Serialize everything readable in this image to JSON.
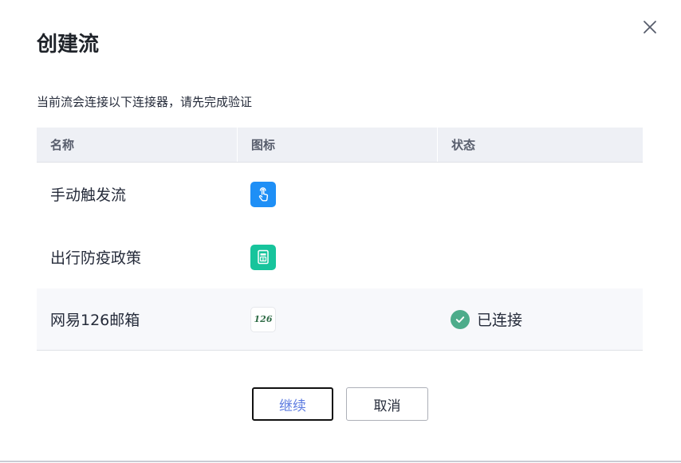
{
  "dialog": {
    "title": "创建流",
    "description": "当前流会连接以下连接器，请先完成验证",
    "close_icon": "close-icon"
  },
  "table": {
    "headers": [
      "名称",
      "图标",
      "状态"
    ],
    "rows": [
      {
        "name": "手动触发流",
        "icon": "touch-icon",
        "icon_color": "#1e8ff6",
        "status": ""
      },
      {
        "name": "出行防疫政策",
        "icon": "document-icon",
        "icon_color": "#17c49c",
        "status": ""
      },
      {
        "name": "网易126邮箱",
        "icon": "126-logo-icon",
        "icon_text": "126",
        "status": "已连接",
        "status_icon": "check-circle-icon",
        "status_color": "#4dac8b"
      }
    ]
  },
  "buttons": {
    "continue_label": "继续",
    "cancel_label": "取消"
  }
}
